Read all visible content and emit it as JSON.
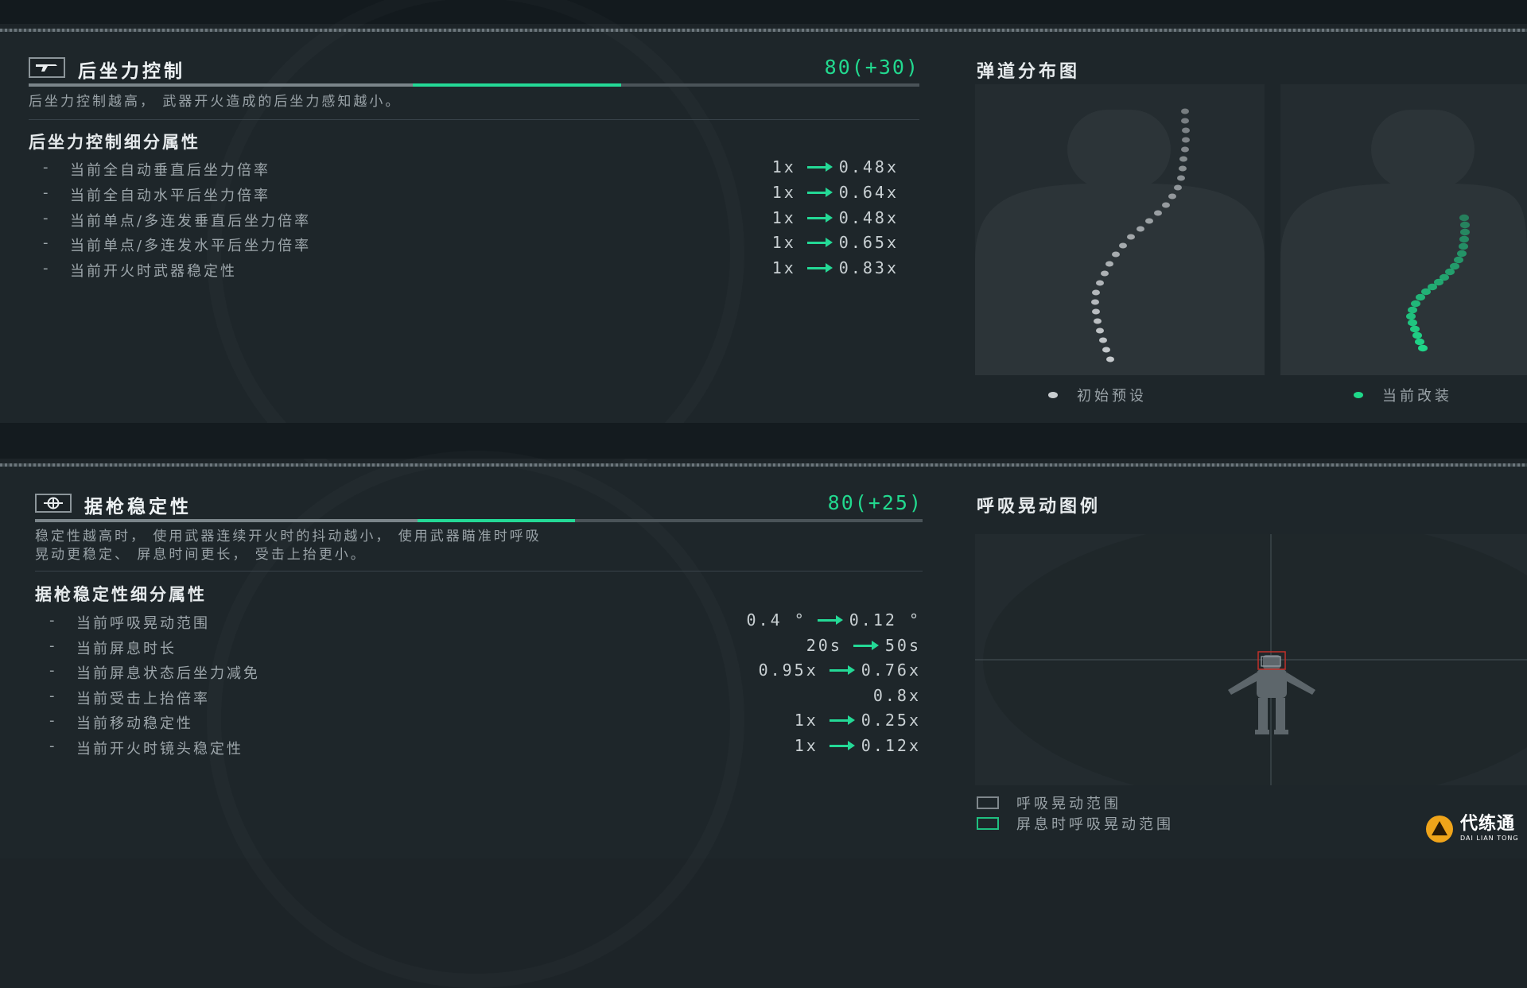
{
  "recoil": {
    "title": "后坐力控制",
    "score": "80(+30)",
    "progress_base": 0.56,
    "progress_bonus": 0.33,
    "description": "后坐力控制越高， 武器开火造成的后坐力感知越小。",
    "subtitle": "后坐力控制细分属性",
    "rows": [
      {
        "name": "当前全自动垂直后坐力倍率",
        "from": "1x",
        "to": "0.48x"
      },
      {
        "name": "当前全自动水平后坐力倍率",
        "from": "1x",
        "to": "0.64x"
      },
      {
        "name": "当前单点/多连发垂直后坐力倍率",
        "from": "1x",
        "to": "0.48x"
      },
      {
        "name": "当前单点/多连发水平后坐力倍率",
        "from": "1x",
        "to": "0.65x"
      },
      {
        "name": "当前开火时武器稳定性",
        "from": "1x",
        "to": "0.83x"
      }
    ]
  },
  "ballistic": {
    "title": "弹道分布图",
    "legend_default": "初始预设",
    "legend_current": "当前改装",
    "default_color": "#c9cdd0",
    "current_color": "#1fd98a"
  },
  "stability": {
    "title": "据枪稳定性",
    "score": "80(+25)",
    "progress_base": 0.56,
    "progress_bonus": 0.25,
    "description_line1": "稳定性越高时， 使用武器连续开火时的抖动越小， 使用武器瞄准时呼吸",
    "description_line2": "晃动更稳定、 屏息时间更长， 受击上抬更小。",
    "subtitle": "据枪稳定性细分属性",
    "rows": [
      {
        "name": "当前呼吸晃动范围",
        "from": "0.4 °",
        "to": "0.12 °"
      },
      {
        "name": "当前屏息时长",
        "from": "20s",
        "to": "50s"
      },
      {
        "name": "当前屏息状态后坐力减免",
        "from": "0.95x",
        "to": "0.76x"
      },
      {
        "name": "当前受击上抬倍率",
        "from": "",
        "to": "0.8x"
      },
      {
        "name": "当前移动稳定性",
        "from": "1x",
        "to": "0.25x"
      },
      {
        "name": "当前开火时镜头稳定性",
        "from": "1x",
        "to": "0.12x"
      }
    ]
  },
  "breathing": {
    "title": "呼吸晃动图例",
    "legend_range": "呼吸晃动范围",
    "legend_hold": "屏息时呼吸晃动范围"
  },
  "watermark": {
    "brand": "代练通",
    "brand_sub": "DAI LIAN TONG"
  },
  "colors": {
    "accent": "#24d996",
    "background": "#1e262a"
  },
  "icons": [
    "gun-icon",
    "crosshair-icon",
    "soldier-figure-icon"
  ]
}
